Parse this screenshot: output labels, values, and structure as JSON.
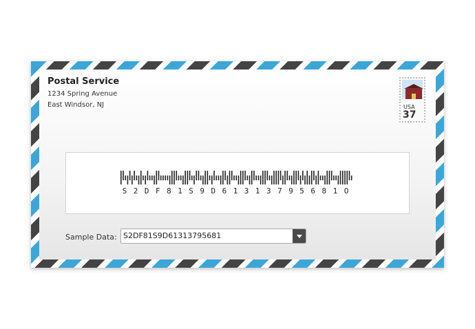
{
  "sender": {
    "name": "Postal Service",
    "address_line1": "1234 Spring Avenue",
    "address_line2": "East Windsor, NJ"
  },
  "stamp": {
    "country": "USA",
    "value": "37"
  },
  "barcode": {
    "text": "S2DF81S9D61313795681O",
    "characters": [
      "S",
      "2",
      "D",
      "F",
      "8",
      "1",
      "S",
      "9",
      "D",
      "6",
      "1",
      "3",
      "1",
      "3",
      "7",
      "9",
      "5",
      "6",
      "8",
      "1",
      "O"
    ],
    "colors": {
      "bar": "#222222"
    }
  },
  "sample_data": {
    "label": "Sample Data:",
    "value": "S2DF81S9D61313795681",
    "icon": "chevron-down-icon"
  },
  "theme": {
    "stripe_blue": "#3ea6d6",
    "stripe_dark": "#444444"
  }
}
